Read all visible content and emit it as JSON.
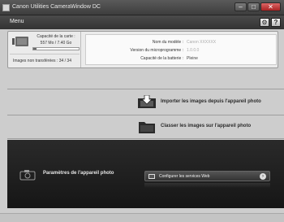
{
  "window": {
    "title": "Canon Utilities CameraWindow DC"
  },
  "menubar": {
    "menu_label": "Menu",
    "settings_label": "⚙",
    "help_label": "?"
  },
  "card": {
    "capacity_label": "Capacité de la carte :",
    "capacity_value": "557 Mo / 7.40 Go",
    "used_fraction": 0.07,
    "non_transferred_text": "Images non transférées : 34 / 34"
  },
  "camera_info": {
    "model_label": "Nom du modèle :",
    "model_value": "Canon XXXXXX",
    "firmware_label": "Version du microprogramme :",
    "firmware_value": "1.0.0.0",
    "battery_label": "Capacité de la batterie :",
    "battery_value": "Pleine"
  },
  "actions": {
    "import_label": "Importer les images depuis l'appareil photo",
    "classify_label": "Classer les images sur l'appareil photo"
  },
  "camera_settings": {
    "label": "Paramètres de l'appareil photo",
    "web_services_label": "Configurer les services Web",
    "arrow": "›"
  },
  "colors": {
    "titlebar": "#3d3d3d",
    "dark_panel": "#1f1f1f",
    "background": "#cdcdcd"
  }
}
